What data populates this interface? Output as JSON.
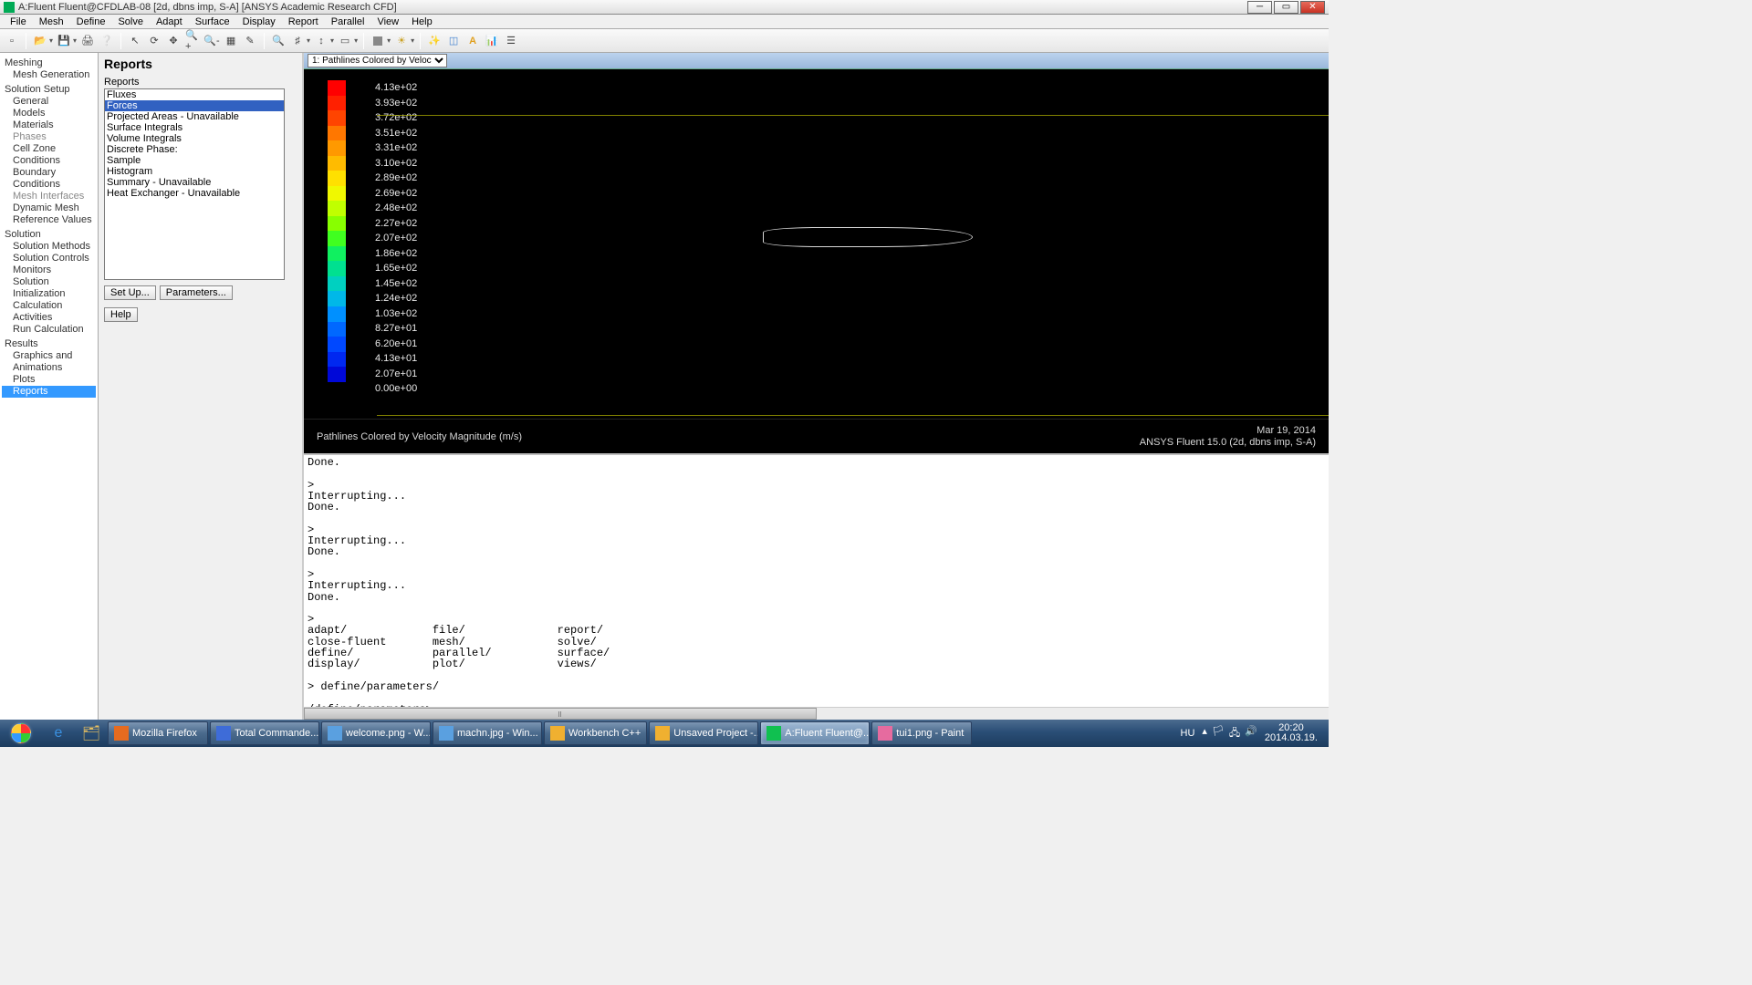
{
  "window": {
    "title": "A:Fluent Fluent@CFDLAB-08  [2d, dbns imp, S-A] [ANSYS Academic Research CFD]"
  },
  "menubar": [
    "File",
    "Mesh",
    "Define",
    "Solve",
    "Adapt",
    "Surface",
    "Display",
    "Report",
    "Parallel",
    "View",
    "Help"
  ],
  "tree": {
    "meshing": "Meshing",
    "mesh_gen": "Mesh Generation",
    "solution_setup": "Solution Setup",
    "general": "General",
    "models": "Models",
    "materials": "Materials",
    "phases": "Phases",
    "cell_zone": "Cell Zone Conditions",
    "boundary": "Boundary Conditions",
    "mesh_if": "Mesh Interfaces",
    "dyn_mesh": "Dynamic Mesh",
    "ref_vals": "Reference Values",
    "solution": "Solution",
    "sol_methods": "Solution Methods",
    "sol_controls": "Solution Controls",
    "monitors": "Monitors",
    "sol_init": "Solution Initialization",
    "calc_act": "Calculation Activities",
    "run_calc": "Run Calculation",
    "results": "Results",
    "graphics": "Graphics and Animations",
    "plots": "Plots",
    "reports": "Reports"
  },
  "reports_panel": {
    "title": "Reports",
    "list_label": "Reports",
    "items": [
      "Fluxes",
      "Forces",
      "Projected Areas - Unavailable",
      "Surface Integrals",
      "Volume Integrals",
      "Discrete Phase:",
      "  Sample",
      "  Histogram",
      "  Summary - Unavailable",
      "Heat Exchanger - Unavailable"
    ],
    "selected_index": 1,
    "btn_setup": "Set Up...",
    "btn_params": "Parameters...",
    "btn_help": "Help"
  },
  "graph": {
    "dropdown": "1: Pathlines Colored by Veloc",
    "caption_left": "Pathlines Colored by Velocity Magnitude (m/s)",
    "caption_date": "Mar 19, 2014",
    "caption_ver": "ANSYS Fluent 15.0 (2d, dbns imp, S-A)"
  },
  "chart_data": {
    "type": "colormap-legend",
    "title": "Pathlines Colored by Velocity Magnitude (m/s)",
    "labels": [
      "4.13e+02",
      "3.93e+02",
      "3.72e+02",
      "3.51e+02",
      "3.31e+02",
      "3.10e+02",
      "2.89e+02",
      "2.69e+02",
      "2.48e+02",
      "2.27e+02",
      "2.07e+02",
      "1.86e+02",
      "1.65e+02",
      "1.45e+02",
      "1.24e+02",
      "1.03e+02",
      "8.27e+01",
      "6.20e+01",
      "4.13e+01",
      "2.07e+01",
      "0.00e+00"
    ],
    "colors": [
      "#ff0000",
      "#ff2000",
      "#ff4400",
      "#ff7700",
      "#ff9900",
      "#ffbb00",
      "#ffe000",
      "#f0f800",
      "#c0ff00",
      "#88ff00",
      "#40ff20",
      "#10f060",
      "#00e090",
      "#00d0c0",
      "#00b8e8",
      "#0090ff",
      "#0068ff",
      "#0048ff",
      "#0028f0",
      "#0008d8"
    ]
  },
  "console": "Done.\n\n> \nInterrupting...\nDone.\n\n> \nInterrupting...\nDone.\n\n> \nInterrupting...\nDone.\n\n> \nadapt/             file/              report/\nclose-fluent       mesh/              solve/\ndefine/            parallel/          surface/\ndisplay/           plot/              views/\n\n> define/parameters/\n\n/define/parameters>",
  "taskbar": {
    "items": [
      {
        "label": "Mozilla Firefox",
        "color": "#e66b1f"
      },
      {
        "label": "Total Commande...",
        "color": "#3e6cd8"
      },
      {
        "label": "welcome.png - W...",
        "color": "#5aa0e0"
      },
      {
        "label": "machn.jpg - Win...",
        "color": "#5aa0e0"
      },
      {
        "label": "Workbench C++",
        "color": "#f0b030"
      },
      {
        "label": "Unsaved Project -...",
        "color": "#f0b030"
      },
      {
        "label": "A:Fluent Fluent@...",
        "color": "#10c050"
      },
      {
        "label": "tui1.png - Paint",
        "color": "#e66b9f"
      }
    ],
    "active_index": 6,
    "lang": "HU",
    "time": "20:20",
    "date": "2014.03.19."
  }
}
